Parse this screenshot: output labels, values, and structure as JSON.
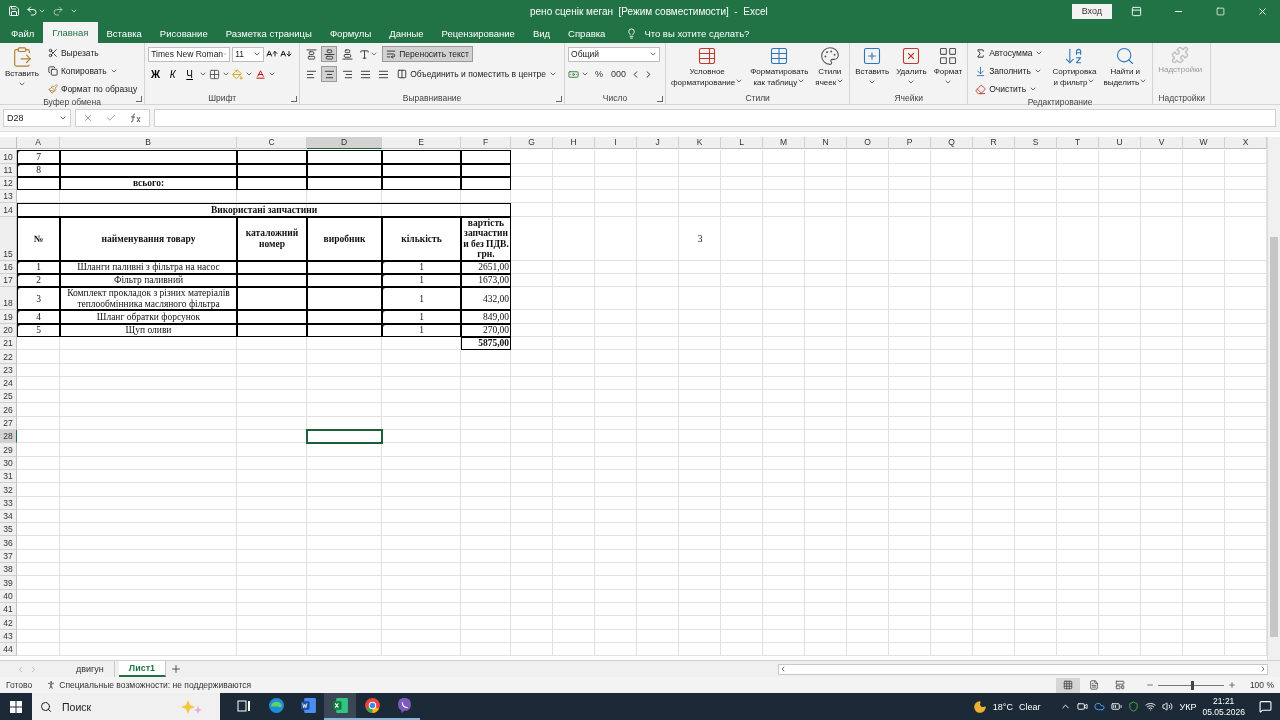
{
  "title_bar": {
    "title": "рено сценік меган  [Режим совместимости]  -  Excel",
    "signin": "Вход"
  },
  "tabs": [
    {
      "label": "Файл",
      "selected": false
    },
    {
      "label": "Главная",
      "selected": true
    },
    {
      "label": "Вставка",
      "selected": false
    },
    {
      "label": "Рисование",
      "selected": false
    },
    {
      "label": "Разметка страницы",
      "selected": false
    },
    {
      "label": "Формулы",
      "selected": false
    },
    {
      "label": "Данные",
      "selected": false
    },
    {
      "label": "Рецензирование",
      "selected": false
    },
    {
      "label": "Вид",
      "selected": false
    },
    {
      "label": "Справка",
      "selected": false
    }
  ],
  "tell_me": {
    "placeholder": "Что вы хотите сделать?"
  },
  "ribbon": {
    "clipboard": {
      "label": "Буфер обмена",
      "paste": "Вставить",
      "cut": "Вырезать",
      "copy": "Копировать",
      "painter": "Формат по образцу"
    },
    "font": {
      "label": "Шрифт",
      "font": "Times New Roman",
      "size": "11",
      "styles": [
        "Ж",
        "К",
        "Ч"
      ]
    },
    "alignment": {
      "label": "Выравнивание",
      "vertical": [
        {
          "selected": false
        },
        {
          "selected": true
        },
        {
          "selected": false
        }
      ],
      "horizontal": [
        {
          "selected": false
        },
        {
          "selected": true
        },
        {
          "selected": false
        }
      ],
      "wrap": {
        "label": "Переносить текст",
        "selected": true
      },
      "merge": "Объединить и поместить в центре"
    },
    "number": {
      "label": "Число",
      "format": "Общий",
      "symbols": [
        "%",
        "000"
      ]
    },
    "styles": {
      "label": "Стили",
      "buttons": [
        {
          "kind": "conditional",
          "label": "Условное\nформатирование"
        },
        {
          "kind": "table",
          "label": "Форматировать\nкак таблицу"
        },
        {
          "kind": "cellstyles",
          "label": "Стили\nячеек"
        }
      ]
    },
    "cells": {
      "label": "Ячейки",
      "buttons": [
        {
          "kind": "insert",
          "label": "Вставить"
        },
        {
          "kind": "delete",
          "label": "Удалить"
        },
        {
          "kind": "format",
          "label": "Формат"
        }
      ]
    },
    "editing": {
      "label": "Редактирование",
      "small": [
        {
          "kind": "sum",
          "label": "Автосумма"
        },
        {
          "kind": "fill",
          "label": "Заполнить"
        },
        {
          "kind": "clear",
          "label": "Очистить"
        }
      ],
      "buttons": [
        {
          "kind": "sort",
          "label": "Сортировка\nи фильтр"
        },
        {
          "kind": "find",
          "label": "Найти и\nвыделить"
        }
      ]
    },
    "addins": {
      "label": "Надстройки",
      "button": {
        "label": "Надстройки",
        "disabled": true
      }
    }
  },
  "formula_bar": {
    "name_box": "D28"
  },
  "columns": [
    {
      "label": "A",
      "selected": false
    },
    {
      "label": "B",
      "selected": false
    },
    {
      "label": "C",
      "selected": false
    },
    {
      "label": "D",
      "selected": true
    },
    {
      "label": "E",
      "selected": false
    },
    {
      "label": "F",
      "selected": false
    },
    {
      "label": "G",
      "selected": false
    },
    {
      "label": "H",
      "selected": false
    },
    {
      "label": "I",
      "selected": false
    },
    {
      "label": "J",
      "selected": false
    },
    {
      "label": "K",
      "selected": false
    },
    {
      "label": "L",
      "selected": false
    },
    {
      "label": "M",
      "selected": false
    },
    {
      "label": "N",
      "selected": false
    },
    {
      "label": "O",
      "selected": false
    },
    {
      "label": "P",
      "selected": false
    },
    {
      "label": "Q",
      "selected": false
    },
    {
      "label": "R",
      "selected": false
    },
    {
      "label": "S",
      "selected": false
    },
    {
      "label": "T",
      "selected": false
    },
    {
      "label": "U",
      "selected": false
    },
    {
      "label": "V",
      "selected": false
    },
    {
      "label": "W",
      "selected": false
    },
    {
      "label": "X",
      "selected": false
    }
  ],
  "rows": [
    {
      "label": "10",
      "selected": false,
      "kind": "table",
      "cells": [
        {
          "text": "7",
          "flag": true
        }
      ]
    },
    {
      "label": "11",
      "selected": false,
      "kind": "table",
      "cells": [
        {
          "text": "8",
          "flag": true
        }
      ]
    },
    {
      "label": "12",
      "selected": false,
      "kind": "sum",
      "cells": [
        {},
        {
          "text": "всього:",
          "flag": false
        }
      ]
    },
    {
      "label": "13",
      "selected": false,
      "kind": "plain"
    },
    {
      "label": "14",
      "selected": false,
      "kind": "title",
      "cells": [
        {
          "text": "Використані запчастини",
          "flag": false
        }
      ]
    },
    {
      "label": "15",
      "selected": false,
      "kind": "header",
      "cells": [
        {
          "text": "№",
          "flag": false
        },
        {
          "text": "найменування товару",
          "flag": false
        },
        {
          "text": "каталожний номер",
          "flag": false
        },
        {
          "text": "виробник",
          "flag": false
        },
        {
          "text": "кількість",
          "flag": false
        },
        {
          "text": "вартість запчастин и без ПДВ. грн.",
          "flag": false
        },
        {},
        {},
        {},
        {},
        {
          "text": "3",
          "flag": false
        }
      ]
    },
    {
      "label": "16",
      "selected": false,
      "kind": "table",
      "cells": [
        {
          "text": "1",
          "flag": true
        },
        {
          "text": "Шланги паливні з фільтра на насос",
          "flag": false
        },
        {},
        {},
        {
          "text": "1",
          "flag": true
        },
        {
          "text": "2651,00",
          "flag": false
        }
      ]
    },
    {
      "label": "17",
      "selected": false,
      "kind": "table",
      "cells": [
        {
          "text": "2",
          "flag": true
        },
        {
          "text": "Фільтр паливний",
          "flag": false
        },
        {},
        {},
        {
          "text": "1",
          "flag": true
        },
        {
          "text": "1673,00",
          "flag": false
        }
      ]
    },
    {
      "label": "18",
      "selected": false,
      "kind": "table",
      "cells": [
        {
          "text": "3",
          "flag": true
        },
        {
          "text": "Комплект прокладок з різних матеріалів теплообмінника масляного фільтра",
          "flag": false
        },
        {},
        {},
        {
          "text": "1",
          "flag": true
        },
        {
          "text": "432,00",
          "flag": false
        }
      ]
    },
    {
      "label": "19",
      "selected": false,
      "kind": "table",
      "cells": [
        {
          "text": "4",
          "flag": true
        },
        {
          "text": "Шланг обратки форсунок",
          "flag": false
        },
        {},
        {},
        {
          "text": "1",
          "flag": true
        },
        {
          "text": "849,00",
          "flag": false
        }
      ]
    },
    {
      "label": "20",
      "selected": false,
      "kind": "table",
      "cells": [
        {
          "text": "5",
          "flag": true
        },
        {
          "text": "Щуп оливи",
          "flag": false
        },
        {},
        {},
        {
          "text": "1",
          "flag": true
        },
        {
          "text": "270,00",
          "flag": false
        }
      ]
    },
    {
      "label": "21",
      "selected": false,
      "kind": "total",
      "cells": [
        {},
        {},
        {},
        {},
        {},
        {
          "text": "5875,00",
          "flag": false
        }
      ]
    },
    {
      "label": "22",
      "selected": false,
      "kind": "plain"
    },
    {
      "label": "23",
      "selected": false,
      "kind": "plain"
    },
    {
      "label": "24",
      "selected": false,
      "kind": "plain"
    },
    {
      "label": "25",
      "selected": false,
      "kind": "plain"
    },
    {
      "label": "26",
      "selected": false,
      "kind": "plain"
    },
    {
      "label": "27",
      "selected": false,
      "kind": "plain"
    },
    {
      "label": "28",
      "selected": true,
      "kind": "plain"
    },
    {
      "label": "29",
      "selected": false,
      "kind": "plain"
    },
    {
      "label": "30",
      "selected": false,
      "kind": "plain"
    },
    {
      "label": "31",
      "selected": false,
      "kind": "plain"
    },
    {
      "label": "32",
      "selected": false,
      "kind": "plain"
    },
    {
      "label": "33",
      "selected": false,
      "kind": "plain"
    },
    {
      "label": "34",
      "selected": false,
      "kind": "plain"
    },
    {
      "label": "35",
      "selected": false,
      "kind": "plain"
    },
    {
      "label": "36",
      "selected": false,
      "kind": "plain"
    },
    {
      "label": "37",
      "selected": false,
      "kind": "plain"
    },
    {
      "label": "38",
      "selected": false,
      "kind": "plain"
    },
    {
      "label": "39",
      "selected": false,
      "kind": "plain"
    },
    {
      "label": "40",
      "selected": false,
      "kind": "plain"
    },
    {
      "label": "41",
      "selected": false,
      "kind": "plain"
    },
    {
      "label": "42",
      "selected": false,
      "kind": "plain"
    },
    {
      "label": "43",
      "selected": false,
      "kind": "plain"
    },
    {
      "label": "44",
      "selected": false,
      "kind": "plain"
    }
  ],
  "sheet_tabs": [
    {
      "label": "двигун",
      "selected": false
    },
    {
      "label": "Лист1",
      "selected": true
    }
  ],
  "status_bar": {
    "ready": "Готово",
    "accessibility": "Специальные возможности: не поддерживаются",
    "views": [
      {
        "kind": "normal",
        "selected": true
      },
      {
        "kind": "layout",
        "selected": false
      },
      {
        "kind": "pagebreak",
        "selected": false
      }
    ],
    "zoom": {
      "level": 0.5,
      "reading": "100 %"
    }
  },
  "taskbar": {
    "search": {
      "placeholder": "Поиск"
    },
    "apps": [
      {
        "kind": "taskview",
        "running": false,
        "selected": false
      },
      {
        "kind": "edge",
        "running": false,
        "selected": false
      },
      {
        "kind": "word",
        "running": false,
        "selected": false
      },
      {
        "kind": "excel",
        "running": true,
        "selected": true
      },
      {
        "kind": "chrome",
        "running": true,
        "selected": false
      },
      {
        "kind": "viber",
        "running": true,
        "selected": false
      }
    ],
    "weather": {
      "temp": "18°C",
      "condition": "Clear"
    },
    "language": "УКР",
    "time": "21:21",
    "date": "05.05.2026"
  }
}
